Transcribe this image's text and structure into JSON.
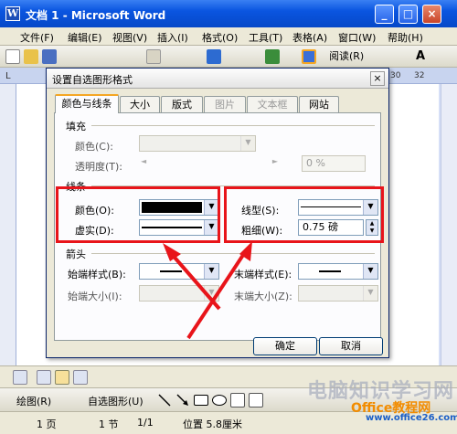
{
  "window": {
    "title": "文档 1 - Microsoft Word",
    "app_icon": "W"
  },
  "menu": [
    "文件(F)",
    "编辑(E)",
    "视图(V)",
    "插入(I)",
    "格式(O)",
    "工具(T)",
    "表格(A)",
    "窗口(W)",
    "帮助(H)"
  ],
  "toolbar": {
    "read_label": "阅读(R)"
  },
  "ruler": {
    "left": "L",
    "nums": [
      "30",
      "32"
    ]
  },
  "dialog": {
    "title": "设置自选图形格式",
    "tabs": [
      "颜色与线条",
      "大小",
      "版式",
      "图片",
      "文本框",
      "网站"
    ],
    "fill": {
      "section": "填充",
      "color_label": "颜色(C):",
      "transparency_label": "透明度(T):",
      "transparency_value": "0 %"
    },
    "line": {
      "section": "线条",
      "color_label": "颜色(O):",
      "dash_label": "虚实(D):",
      "style_label": "线型(S):",
      "weight_label": "粗细(W):",
      "weight_value": "0.75 磅"
    },
    "arrows": {
      "section": "箭头",
      "begin_style_label": "始端样式(B):",
      "end_style_label": "末端样式(E):",
      "begin_size_label": "始端大小(I):",
      "end_size_label": "末端大小(Z):"
    },
    "ok_label": "确定",
    "cancel_label": "取消"
  },
  "drawbar": {
    "draw_label": "绘图(R)",
    "autoshapes_label": "自选图形(U)"
  },
  "status": {
    "page": "1 页",
    "section": "1 节",
    "pages": "1/1",
    "position": "位置 5.8厘米"
  },
  "watermark": {
    "text": "电脑知识学习网",
    "brand": "Office教程网",
    "url": "www.office26.com"
  },
  "colors": {
    "highlight": "#e8141a",
    "title_blue": "#0a55e0",
    "line_color": "#000000"
  }
}
